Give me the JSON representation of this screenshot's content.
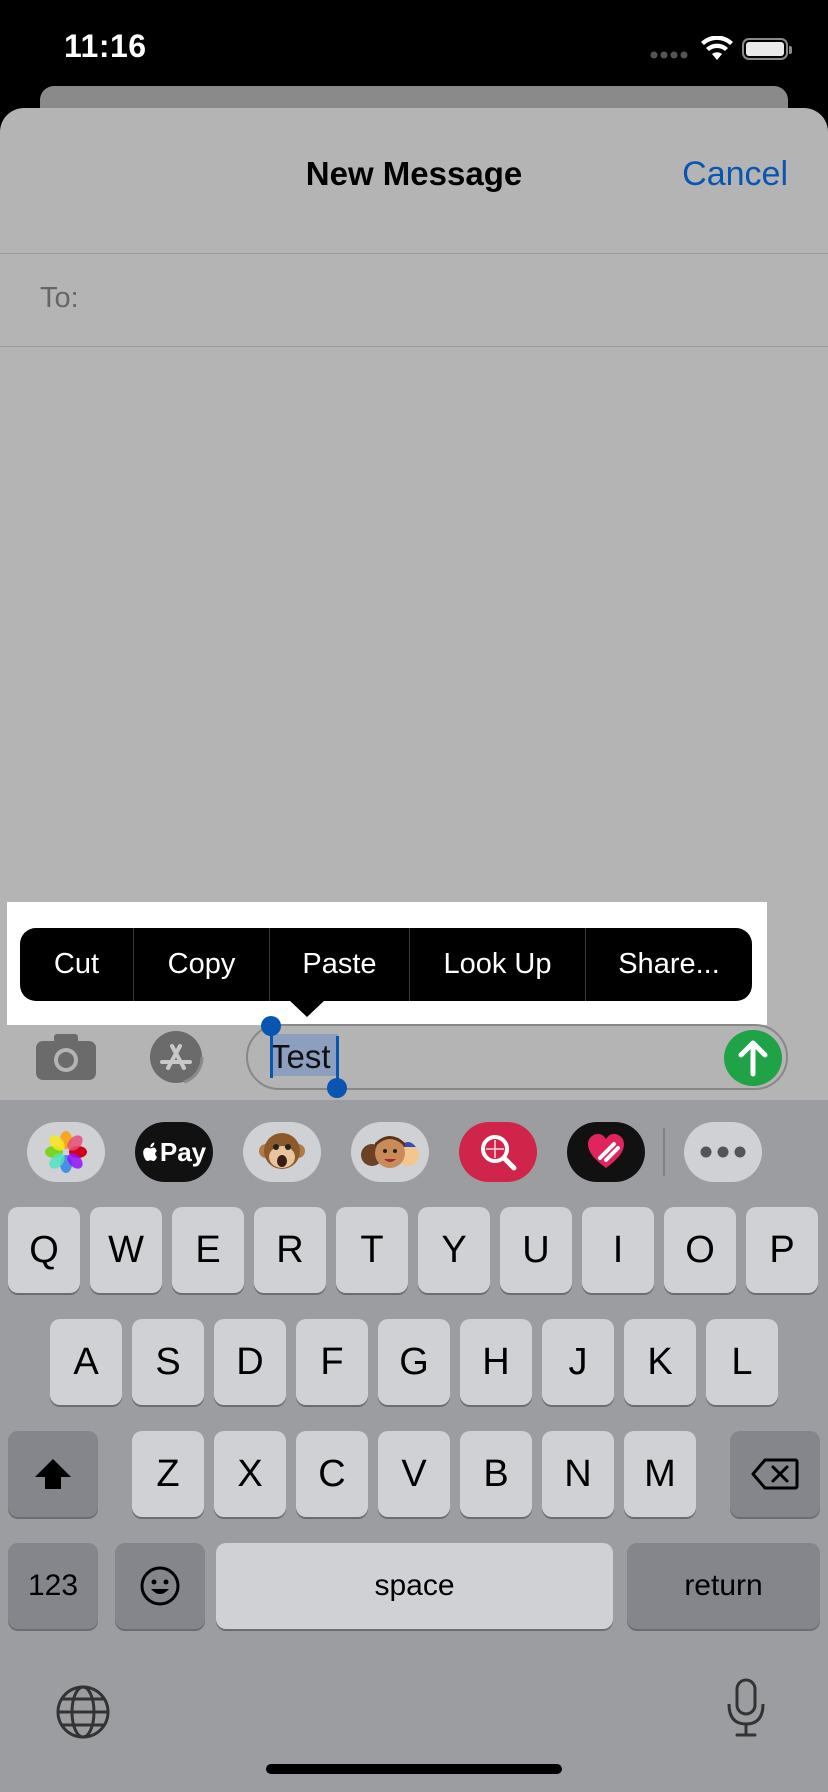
{
  "status_bar": {
    "time": "11:16"
  },
  "nav": {
    "title": "New Message",
    "cancel_label": "Cancel"
  },
  "recipient": {
    "label": "To:"
  },
  "context_menu": {
    "items": [
      "Cut",
      "Copy",
      "Paste",
      "Look Up",
      "Share..."
    ]
  },
  "compose": {
    "text": "Test",
    "selected": "Test"
  },
  "app_drawer": {
    "apps": [
      "photos-icon",
      "apple-pay-icon",
      "animoji-monkey-icon",
      "memoji-icon",
      "images-search-icon",
      "digital-touch-icon",
      "more-icon"
    ],
    "apple_pay_label": "Pay"
  },
  "keyboard": {
    "row1": [
      "Q",
      "W",
      "E",
      "R",
      "T",
      "Y",
      "U",
      "I",
      "O",
      "P"
    ],
    "row2": [
      "A",
      "S",
      "D",
      "F",
      "G",
      "H",
      "J",
      "K",
      "L"
    ],
    "row3": [
      "Z",
      "X",
      "C",
      "V",
      "B",
      "N",
      "M"
    ],
    "numbers_label": "123",
    "space_label": "space",
    "return_label": "return"
  },
  "colors": {
    "accent": "#0a55b2",
    "send": "#1fa346",
    "sheet": "#b4b4b4",
    "keyboard": "#9c9da1"
  }
}
